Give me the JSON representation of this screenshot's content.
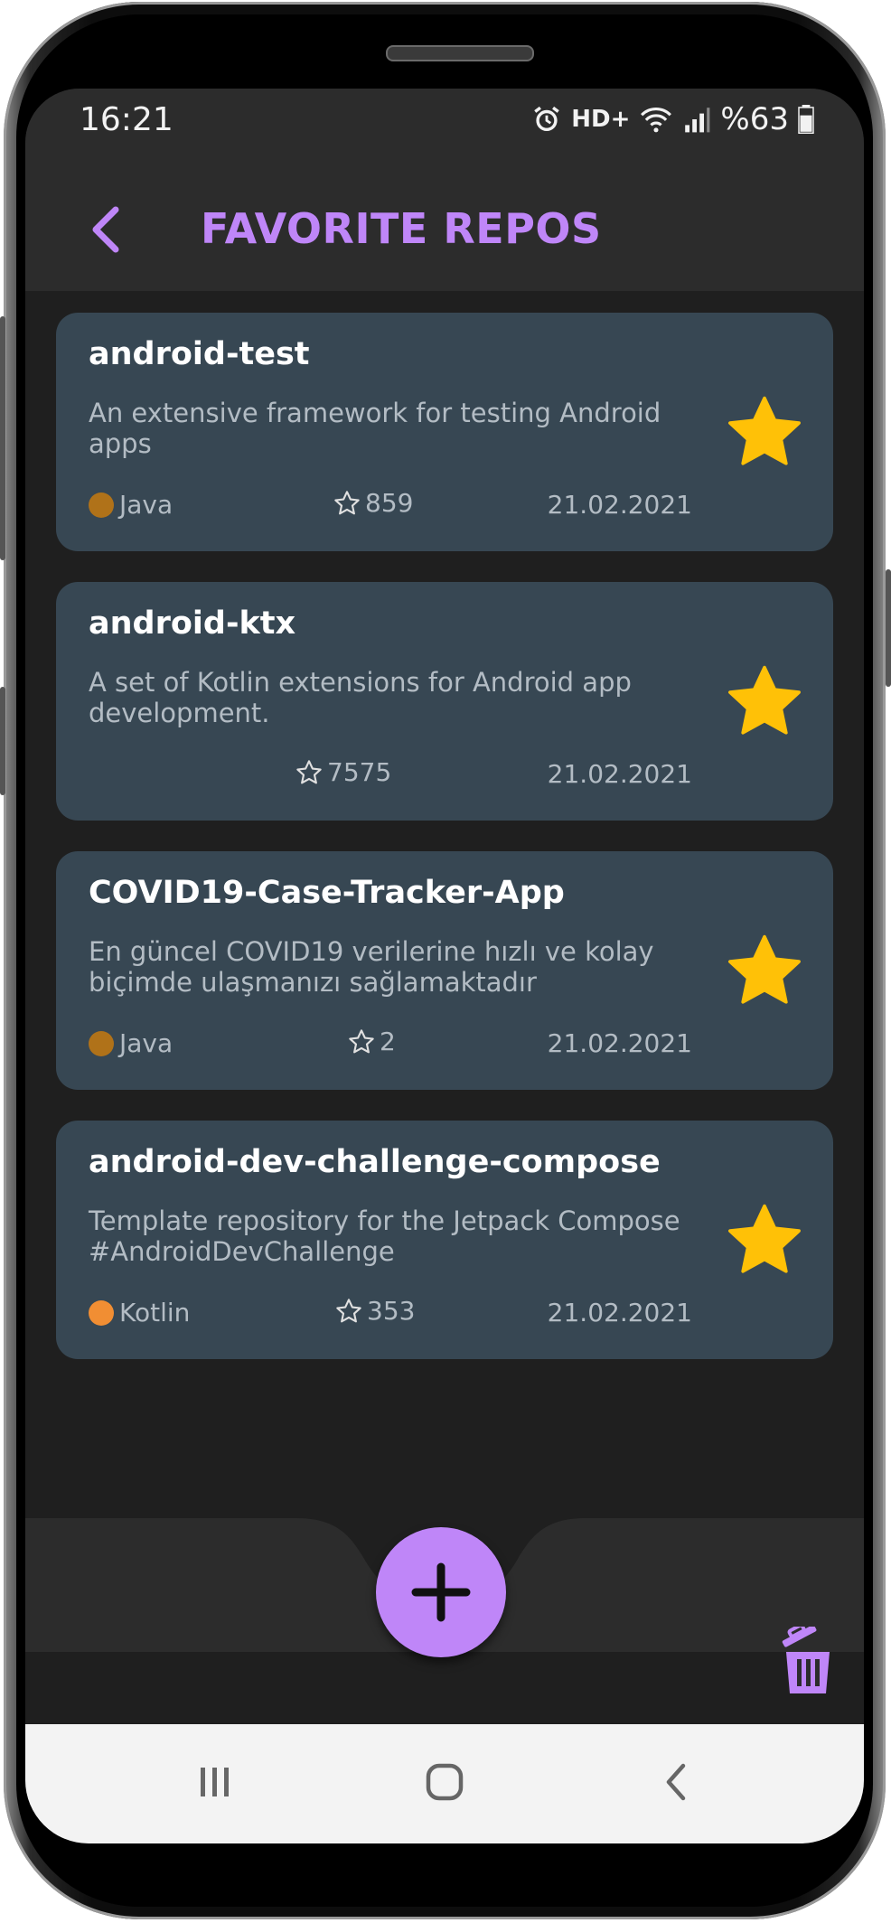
{
  "status_bar": {
    "time": "16:21",
    "hd_label": "HD+",
    "battery": "%63",
    "icons": [
      "alarm-icon",
      "wifi-icon",
      "signal-icon",
      "battery-icon"
    ]
  },
  "app_bar": {
    "title": "FAVORITE REPOS",
    "back_icon": "chevron-left-icon"
  },
  "colors": {
    "accent": "#bf86f8",
    "card_bg": "#374753",
    "star": "#ffc107",
    "java": "#b07219",
    "kotlin": "#f18e33"
  },
  "repos": [
    {
      "name": "android-test",
      "description": "An extensive framework for testing Android apps",
      "language": "Java",
      "stars": "859",
      "date": "21.02.2021"
    },
    {
      "name": "android-ktx",
      "description": "A set of Kotlin extensions for Android app development.",
      "language": "",
      "stars": "7575",
      "date": "21.02.2021"
    },
    {
      "name": "COVID19-Case-Tracker-App",
      "description": "En güncel COVID19 verilerine hızlı ve kolay biçimde ulaşmanızı sağlamaktadır",
      "language": "Java",
      "stars": "2",
      "date": "21.02.2021"
    },
    {
      "name": "android-dev-challenge-compose",
      "description": "Template repository for the Jetpack Compose #AndroidDevChallenge",
      "language": "Kotlin",
      "stars": "353",
      "date": "21.02.2021"
    }
  ],
  "actions": {
    "fab_icon": "plus-icon",
    "delete_icon": "trash-icon"
  },
  "system_nav": {
    "icons": [
      "recents-icon",
      "home-icon",
      "back-icon"
    ]
  }
}
